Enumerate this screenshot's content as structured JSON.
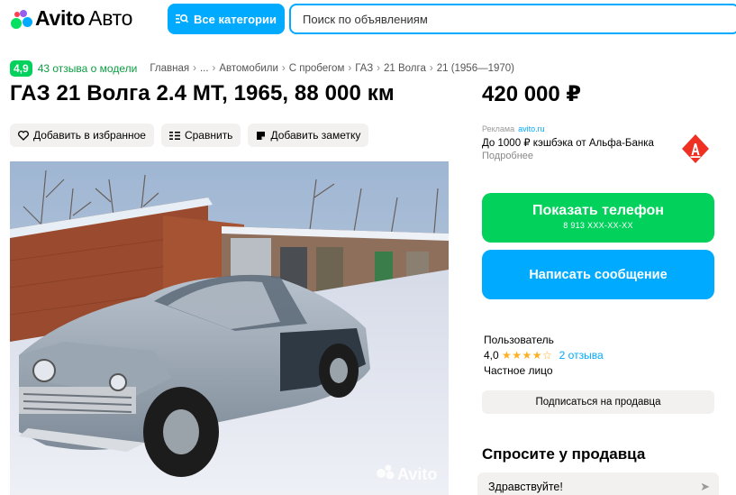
{
  "header": {
    "logo_brand": "Avito",
    "logo_suffix": "Авто",
    "categories_label": "Все категории",
    "search_placeholder": "Поиск по объявлениям",
    "accent_color": "#00aaff"
  },
  "rating": {
    "score": "4,9",
    "reviews_text": "43 отзыва о модели"
  },
  "breadcrumbs": [
    "Главная",
    "...",
    "Автомобили",
    "С пробегом",
    "ГАЗ",
    "21 Волга",
    "21 (1956—1970)"
  ],
  "listing": {
    "title": "ГАЗ 21 Волга 2.4 MT, 1965, 88 000 км",
    "price": "420 000 ₽"
  },
  "actions": {
    "favorite": "Добавить в избранное",
    "compare": "Сравнить",
    "note": "Добавить заметку"
  },
  "ad": {
    "label": "Реклама",
    "source": "avito.ru",
    "text": "До 1000 ₽ кэшбэка от Альфа-Банка",
    "more": "Подробнее"
  },
  "photo": {
    "watermark": "Avito"
  },
  "contact": {
    "show_phone": "Показать телефон",
    "phone_masked": "8 913 XXX-XX-XX",
    "write_message": "Написать сообщение",
    "phone_color": "#02d15c"
  },
  "seller": {
    "name": "Пользователь",
    "rating": "4,0",
    "stars": "★★★★☆",
    "reviews": "2 отзыва",
    "type": "Частное лицо",
    "subscribe": "Подписаться на продавца"
  },
  "ask": {
    "title": "Спросите у продавца",
    "chip": "Здравствуйте!"
  }
}
